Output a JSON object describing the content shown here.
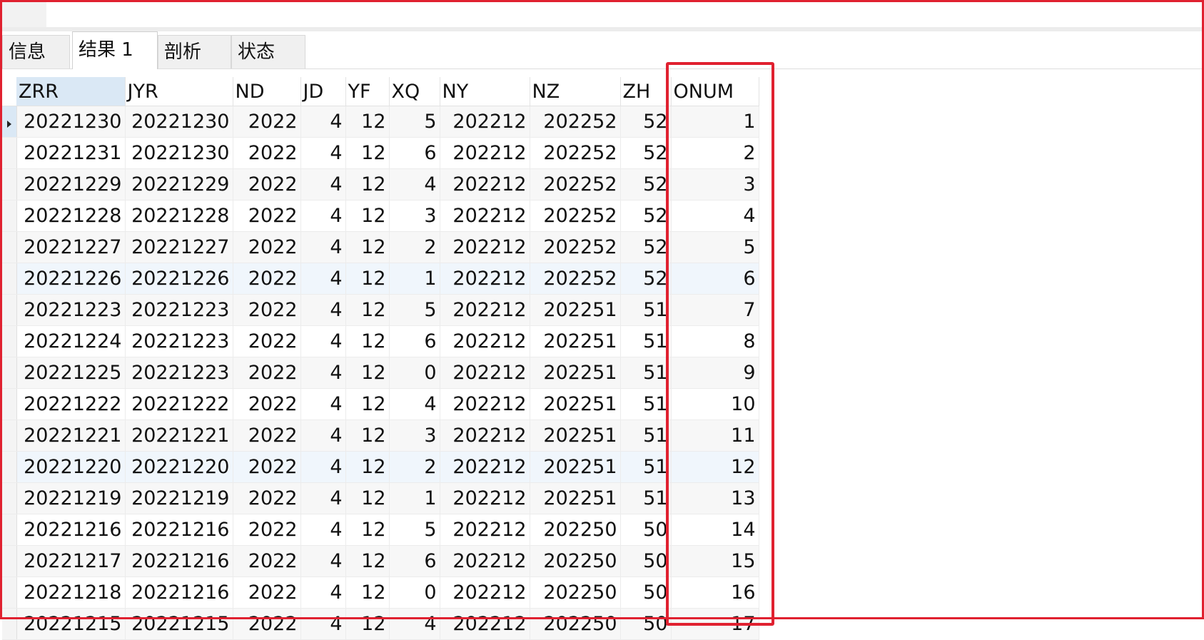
{
  "tabs": [
    {
      "label": "信息",
      "active": false
    },
    {
      "label": "结果 1",
      "active": true
    },
    {
      "label": "剖析",
      "active": false
    },
    {
      "label": "状态",
      "active": false
    }
  ],
  "grid": {
    "columns": [
      "ZRR",
      "JYR",
      "ND",
      "JD",
      "YF",
      "XQ",
      "NY",
      "NZ",
      "ZH",
      "ONUM"
    ],
    "selected_column": "ZRR",
    "highlighted_column": "ONUM",
    "rows": [
      [
        "20221230",
        "20221230",
        "2022",
        "4",
        "12",
        "5",
        "202212",
        "202252",
        "52",
        "1"
      ],
      [
        "20221231",
        "20221230",
        "2022",
        "4",
        "12",
        "6",
        "202212",
        "202252",
        "52",
        "2"
      ],
      [
        "20221229",
        "20221229",
        "2022",
        "4",
        "12",
        "4",
        "202212",
        "202252",
        "52",
        "3"
      ],
      [
        "20221228",
        "20221228",
        "2022",
        "4",
        "12",
        "3",
        "202212",
        "202252",
        "52",
        "4"
      ],
      [
        "20221227",
        "20221227",
        "2022",
        "4",
        "12",
        "2",
        "202212",
        "202252",
        "52",
        "5"
      ],
      [
        "20221226",
        "20221226",
        "2022",
        "4",
        "12",
        "1",
        "202212",
        "202252",
        "52",
        "6"
      ],
      [
        "20221223",
        "20221223",
        "2022",
        "4",
        "12",
        "5",
        "202212",
        "202251",
        "51",
        "7"
      ],
      [
        "20221224",
        "20221223",
        "2022",
        "4",
        "12",
        "6",
        "202212",
        "202251",
        "51",
        "8"
      ],
      [
        "20221225",
        "20221223",
        "2022",
        "4",
        "12",
        "0",
        "202212",
        "202251",
        "51",
        "9"
      ],
      [
        "20221222",
        "20221222",
        "2022",
        "4",
        "12",
        "4",
        "202212",
        "202251",
        "51",
        "10"
      ],
      [
        "20221221",
        "20221221",
        "2022",
        "4",
        "12",
        "3",
        "202212",
        "202251",
        "51",
        "11"
      ],
      [
        "20221220",
        "20221220",
        "2022",
        "4",
        "12",
        "2",
        "202212",
        "202251",
        "51",
        "12"
      ],
      [
        "20221219",
        "20221219",
        "2022",
        "4",
        "12",
        "1",
        "202212",
        "202251",
        "51",
        "13"
      ],
      [
        "20221216",
        "20221216",
        "2022",
        "4",
        "12",
        "5",
        "202212",
        "202250",
        "50",
        "14"
      ],
      [
        "20221217",
        "20221216",
        "2022",
        "4",
        "12",
        "6",
        "202212",
        "202250",
        "50",
        "15"
      ],
      [
        "20221218",
        "20221216",
        "2022",
        "4",
        "12",
        "0",
        "202212",
        "202250",
        "50",
        "16"
      ],
      [
        "20221215",
        "20221215",
        "2022",
        "4",
        "12",
        "4",
        "202212",
        "202250",
        "50",
        "17"
      ]
    ],
    "current_row_index": 0
  },
  "colors": {
    "annotation_red": "#e02130",
    "selected_header_blue": "#dae8f5"
  }
}
